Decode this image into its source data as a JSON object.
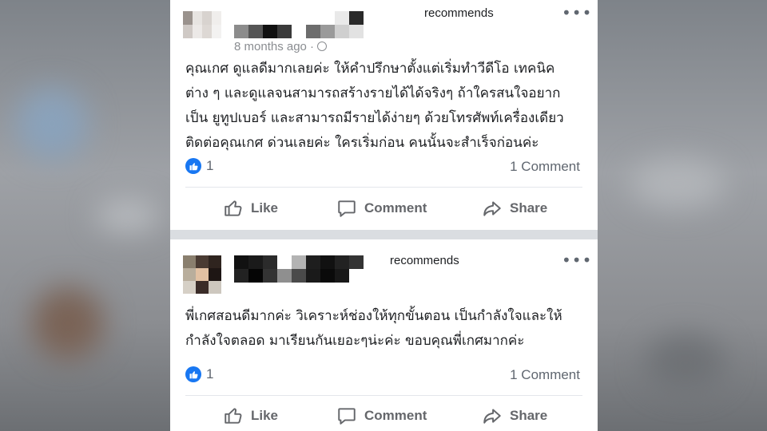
{
  "colors": {
    "accent": "#1877f2",
    "divider": "#dadde1",
    "meta_text": "#8a8d91",
    "action_text": "#65676b"
  },
  "posts": [
    {
      "recommends": "recommends",
      "timestamp": "8 months ago ·",
      "text": "คุณเกศ ดูแลดีมากเลยค่ะ ให้คำปรึกษาตั้งแต่เริ่มทำวีดีโอ เทคนิค\nต่าง ๆ และดูแลจนสามารถสร้างรายได้ได้จริงๆ ถ้าใครสนใจอยาก\nเป็น ยูทูปเบอร์ และสามารถมีรายได้ง่ายๆ ด้วยโทรศัพท์เครื่องเดียว\nติดต่อคุณเกศ ด่วนเลยค่ะ  ใครเริ่มก่อน คนนั้นจะสำเร็จก่อนค่ะ",
      "like_count": "1",
      "comment_count": "1 Comment",
      "actions": {
        "like": "Like",
        "comment": "Comment",
        "share": "Share"
      }
    },
    {
      "recommends": "recommends",
      "timestamp": "",
      "text": "พี่เกศสอนดีมากค่ะ  วิเคราะห์ช่องให้ทุกขั้นตอน เป็นกำลังใจและให้\nกำลังใจตลอด มาเรียนกันเยอะๆน่ะค่ะ ขอบคุณพี่เกศมากค่ะ",
      "like_count": "1",
      "comment_count": "1 Comment",
      "actions": {
        "like": "Like",
        "comment": "Comment",
        "share": "Share"
      }
    }
  ]
}
